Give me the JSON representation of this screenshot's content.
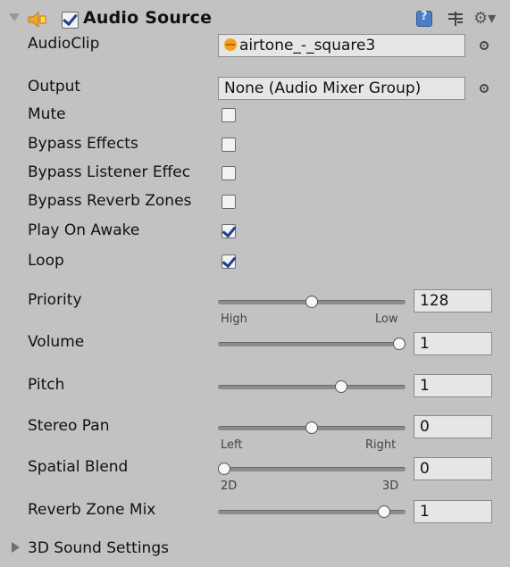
{
  "header": {
    "title": "Audio Source",
    "enabled": true,
    "icons": [
      "speaker-icon",
      "help-icon",
      "preset-icon",
      "gear-icon"
    ]
  },
  "fields": {
    "audio_clip": {
      "label": "AudioClip",
      "value": "airtone_-_square3",
      "icon": "audio-clip-icon"
    },
    "output": {
      "label": "Output",
      "value": "None (Audio Mixer Group)"
    }
  },
  "toggles": [
    {
      "label": "Mute",
      "checked": false
    },
    {
      "label": "Bypass Effects",
      "checked": false
    },
    {
      "label": "Bypass Listener Effec",
      "checked": false
    },
    {
      "label": "Bypass Reverb Zones",
      "checked": false
    },
    {
      "label": "Play On Awake",
      "checked": true
    },
    {
      "label": "Loop",
      "checked": true
    }
  ],
  "sliders": {
    "priority": {
      "label": "Priority",
      "value": "128",
      "min_label": "High",
      "max_label": "Low",
      "fraction": 0.5
    },
    "volume": {
      "label": "Volume",
      "value": "1",
      "fraction": 1.0
    },
    "pitch": {
      "label": "Pitch",
      "value": "1",
      "fraction": 0.66
    },
    "stereo_pan": {
      "label": "Stereo Pan",
      "value": "0",
      "min_label": "Left",
      "max_label": "Right",
      "fraction": 0.5
    },
    "spatial_blend": {
      "label": "Spatial Blend",
      "value": "0",
      "min_label": "2D",
      "max_label": "3D",
      "fraction": 0.0
    },
    "reverb_zone_mix": {
      "label": "Reverb Zone Mix",
      "value": "1",
      "fraction": 0.9
    }
  },
  "sections": {
    "sound_3d": {
      "label": "3D Sound Settings",
      "expanded": false
    }
  },
  "colors": {
    "background": "#c2c2c2",
    "checkmark": "#1f3f8e"
  }
}
